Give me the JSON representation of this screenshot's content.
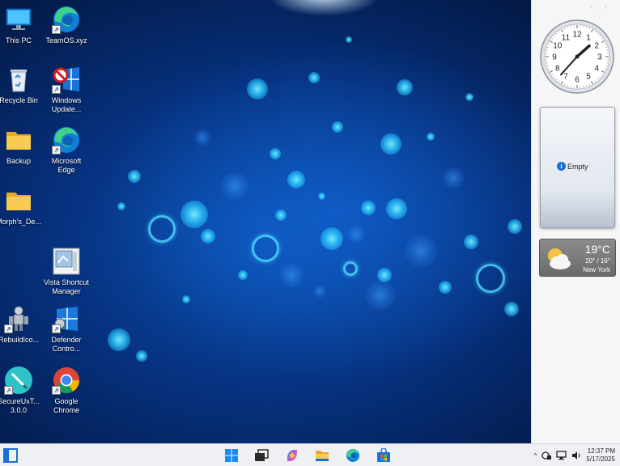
{
  "desktop_icons": [
    {
      "label": "This PC",
      "icon": "monitor-icon",
      "shortcut": false
    },
    {
      "label": "TeamOS.xyz",
      "icon": "edge-icon",
      "shortcut": true
    },
    {
      "label": "Recycle Bin",
      "icon": "recycle-bin-icon",
      "shortcut": false
    },
    {
      "label": "Windows Update...",
      "icon": "windows-update-icon",
      "shortcut": true
    },
    {
      "label": "Backup",
      "icon": "folder-icon",
      "shortcut": false
    },
    {
      "label": "Microsoft Edge",
      "icon": "edge-icon",
      "shortcut": true
    },
    {
      "label": "Morph's_De...",
      "icon": "folder-icon",
      "shortcut": false
    },
    {
      "label": "Vista Shortcut Manager",
      "icon": "shortcut-manager-icon",
      "shortcut": false
    },
    {
      "label": "RebuildIco...",
      "icon": "robot-icon",
      "shortcut": true
    },
    {
      "label": "Defender Contro...",
      "icon": "defender-icon",
      "shortcut": true
    },
    {
      "label": "SecureUxT... 3.0.0",
      "icon": "pen-icon",
      "shortcut": true
    },
    {
      "label": "Google Chrome",
      "icon": "chrome-icon",
      "shortcut": true
    }
  ],
  "sidebar": {
    "arrows": "‹ ›",
    "clock": {
      "numerals": [
        "12",
        "1",
        "2",
        "3",
        "4",
        "5",
        "6",
        "7",
        "8",
        "9",
        "10",
        "11"
      ],
      "hour": 1,
      "minute": 37
    },
    "notes": {
      "text": "Empty"
    },
    "weather": {
      "temp": "19°C",
      "range": "20° / 16°",
      "city": "New York"
    }
  },
  "taskbar": {
    "start": "Windows",
    "pinned": [
      "start-button",
      "task-view",
      "copilot",
      "file-explorer",
      "edge",
      "store"
    ],
    "tray": {
      "chevron": "^",
      "time": "12:37 PM",
      "date": "5/17/2025"
    }
  },
  "colors": {
    "accent": "#1a6fd8",
    "desktop_bg": "#06307c",
    "taskbar_bg": "#eef0f4"
  }
}
